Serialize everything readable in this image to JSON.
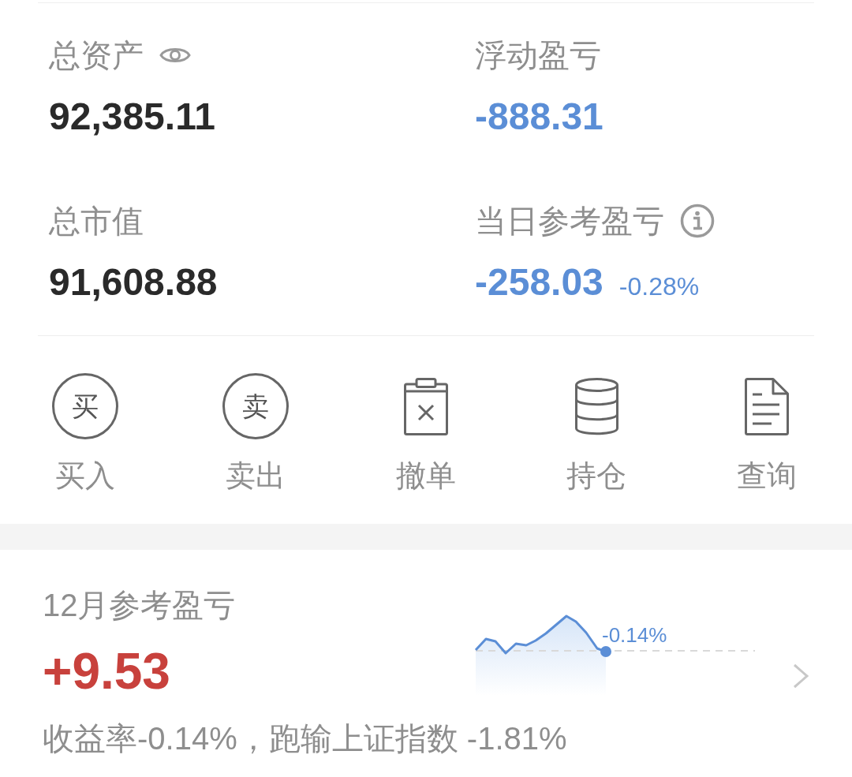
{
  "summary_stats": [
    {
      "label": "总资产",
      "value": "92,385.11",
      "color": "#2a2a2a",
      "kind": "toggle"
    },
    {
      "label": "浮动盈亏",
      "value": "-888.31",
      "color": "#5b8ed6",
      "kind": "plain"
    },
    {
      "label": "总市值",
      "value": "91,608.88",
      "color": "#2a2a2a",
      "kind": "plain"
    },
    {
      "label": "当日参考盈亏",
      "value": "-258.03",
      "change": "-0.28%",
      "color": "#5b8ed6",
      "kind": "info"
    }
  ],
  "actions": [
    {
      "label": "买入",
      "kind": "circle_char",
      "glyph": "买"
    },
    {
      "label": "卖出",
      "kind": "circle_char",
      "glyph": "卖"
    },
    {
      "label": "撤单",
      "kind": "cancel"
    },
    {
      "label": "持仓",
      "kind": "stack"
    },
    {
      "label": "查询",
      "kind": "document"
    }
  ],
  "monthly": {
    "title": "12月参考盈亏",
    "value": "+9.53",
    "color": "#c8413c",
    "sparkline_label": "-0.14%",
    "summary": "收益率-0.14%，跑输上证指数 -1.81%"
  }
}
